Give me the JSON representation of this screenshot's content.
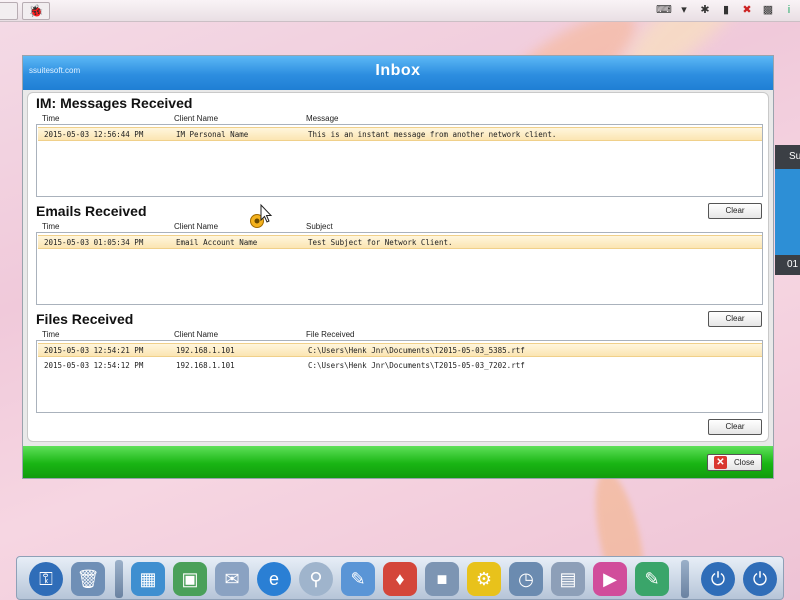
{
  "window": {
    "brand": "ssuitesoft.com",
    "title": "Inbox"
  },
  "im": {
    "title": "IM: Messages Received",
    "headers": [
      "Time",
      "Client Name",
      "Message"
    ],
    "rows": [
      [
        "2015-05-03 12:56:44 PM",
        "IM Personal Name",
        "This is an instant message from another network client."
      ]
    ]
  },
  "emails": {
    "title": "Emails Received",
    "clear_label": "Clear",
    "headers": [
      "Time",
      "Client Name",
      "Subject"
    ],
    "rows": [
      [
        "2015-05-03 01:05:34 PM",
        "Email Account Name",
        "Test Subject for Network Client."
      ]
    ]
  },
  "files": {
    "title": "Files Received",
    "clear_label": "Clear",
    "headers": [
      "Time",
      "Client Name",
      "File Received"
    ],
    "rows": [
      [
        "2015-05-03 12:54:21 PM",
        "192.168.1.101",
        "C:\\Users\\Henk Jnr\\Documents\\T2015-05-03_5385.rtf"
      ],
      [
        "2015-05-03 12:54:12 PM",
        "192.168.1.101",
        "C:\\Users\\Henk Jnr\\Documents\\T2015-05-03_7202.rtf"
      ]
    ]
  },
  "footer": {
    "im_clear_label": "Clear",
    "close_label": "Close"
  },
  "side_widget": {
    "top_text": "Su",
    "bottom_text": "01"
  },
  "dock_icons": [
    "key-icon",
    "trash-icon",
    "app-icon",
    "network-icon",
    "mail-icon",
    "browser-icon",
    "search-icon",
    "notepad-icon",
    "puzzle-icon",
    "disk-icon",
    "gear-icon",
    "folder-clock-icon",
    "slides-icon",
    "media-icon",
    "paint-icon",
    "power-icon",
    "shutdown-icon"
  ],
  "colors": {
    "header_blue": "#2d8ee0",
    "footer_green": "#19b514",
    "selected_row": "#fbe5b2"
  }
}
